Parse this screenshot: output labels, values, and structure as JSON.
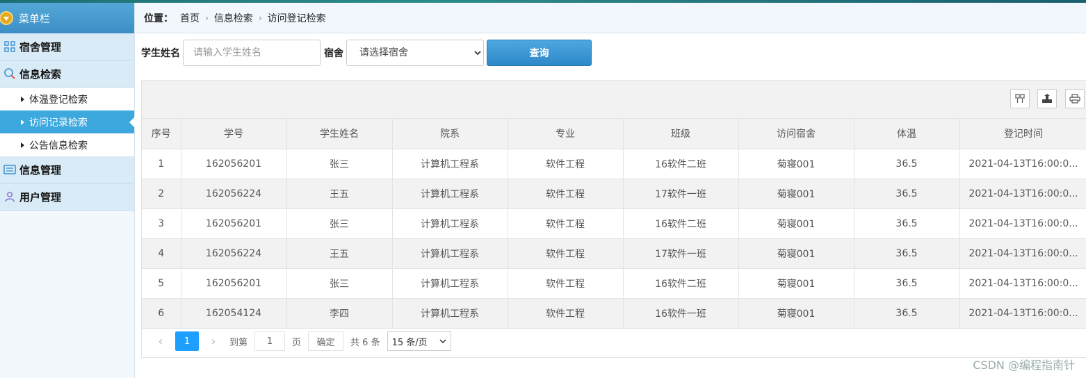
{
  "sidebar": {
    "header": "菜单栏",
    "groups": [
      {
        "label": "宿舍管理",
        "icon": "grid-icon"
      },
      {
        "label": "信息检索",
        "icon": "search-icon"
      },
      {
        "label": "信息管理",
        "icon": "list-icon"
      },
      {
        "label": "用户管理",
        "icon": "user-icon"
      }
    ],
    "sub_items": [
      "体温登记检索",
      "访问记录检索",
      "公告信息检索"
    ],
    "active_sub": "访问记录检索"
  },
  "breadcrumb": {
    "label": "位置：",
    "items": [
      "首页",
      "信息检索",
      "访问登记检索"
    ]
  },
  "search": {
    "name_label": "学生姓名",
    "name_placeholder": "请输入学生姓名",
    "dorm_label": "宿舍",
    "dorm_selected": "请选择宿舍",
    "query_button": "查询"
  },
  "toolbar": {
    "icons": [
      "columns-icon",
      "export-icon",
      "print-icon"
    ]
  },
  "table": {
    "columns": [
      "序号",
      "学号",
      "学生姓名",
      "院系",
      "专业",
      "班级",
      "访问宿舍",
      "体温",
      "登记时间"
    ],
    "rows": [
      [
        "1",
        "162056201",
        "张三",
        "计算机工程系",
        "软件工程",
        "16软件二班",
        "菊寝001",
        "36.5",
        "2021-04-13T16:00:0..."
      ],
      [
        "2",
        "162056224",
        "王五",
        "计算机工程系",
        "软件工程",
        "17软件一班",
        "菊寝001",
        "36.5",
        "2021-04-13T16:00:0..."
      ],
      [
        "3",
        "162056201",
        "张三",
        "计算机工程系",
        "软件工程",
        "16软件二班",
        "菊寝001",
        "36.5",
        "2021-04-13T16:00:0..."
      ],
      [
        "4",
        "162056224",
        "王五",
        "计算机工程系",
        "软件工程",
        "17软件一班",
        "菊寝001",
        "36.5",
        "2021-04-13T16:00:0..."
      ],
      [
        "5",
        "162056201",
        "张三",
        "计算机工程系",
        "软件工程",
        "16软件二班",
        "菊寝001",
        "36.5",
        "2021-04-13T16:00:0..."
      ],
      [
        "6",
        "162054124",
        "李四",
        "计算机工程系",
        "软件工程",
        "16软件一班",
        "菊寝001",
        "36.5",
        "2021-04-13T16:00:0..."
      ]
    ]
  },
  "pager": {
    "prev": "‹",
    "current_page": "1",
    "next": "›",
    "goto_label": "到第",
    "goto_value": "1",
    "page_unit": "页",
    "confirm": "确定",
    "total": "共 6 条",
    "page_size": "15 条/页"
  },
  "watermark": "CSDN @编程指南针",
  "colors": {
    "accent": "#3ca8dd",
    "primary_button": "#2d88c8",
    "active_page": "#1e9fff"
  }
}
